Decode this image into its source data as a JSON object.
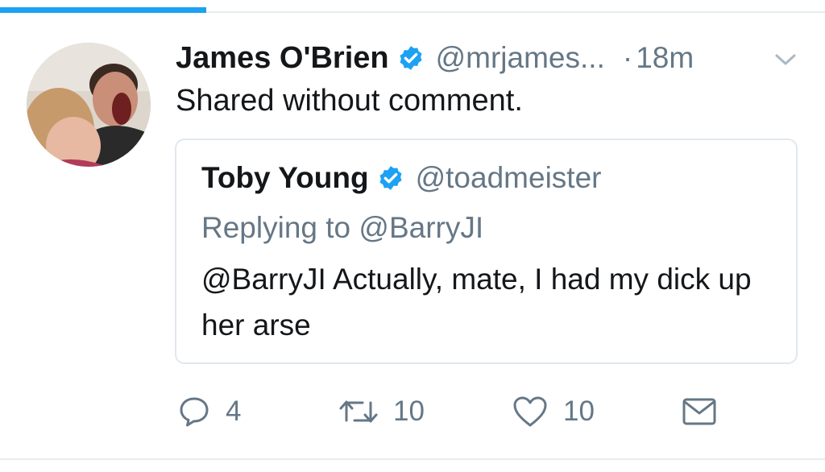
{
  "load_progress": 0.25,
  "colors": {
    "accent": "#1da1f2",
    "text": "#14171a",
    "secondary": "#657786",
    "border": "#e1e8ed"
  },
  "tweet": {
    "display_name": "James O'Brien",
    "verified": true,
    "handle": "@mrjames...",
    "separator": "·",
    "time": "18m",
    "text": "Shared without comment.",
    "avatar_icon": "user-avatar",
    "menu_icon": "chevron-down-icon"
  },
  "quoted_tweet": {
    "display_name": "Toby Young",
    "verified": true,
    "handle": "@toadmeister",
    "replying_to": "Replying to @BarryJI",
    "text": "@BarryJI Actually, mate, I had my dick up her arse"
  },
  "actions": {
    "reply_count": "4",
    "retweet_count": "10",
    "like_count": "10"
  }
}
